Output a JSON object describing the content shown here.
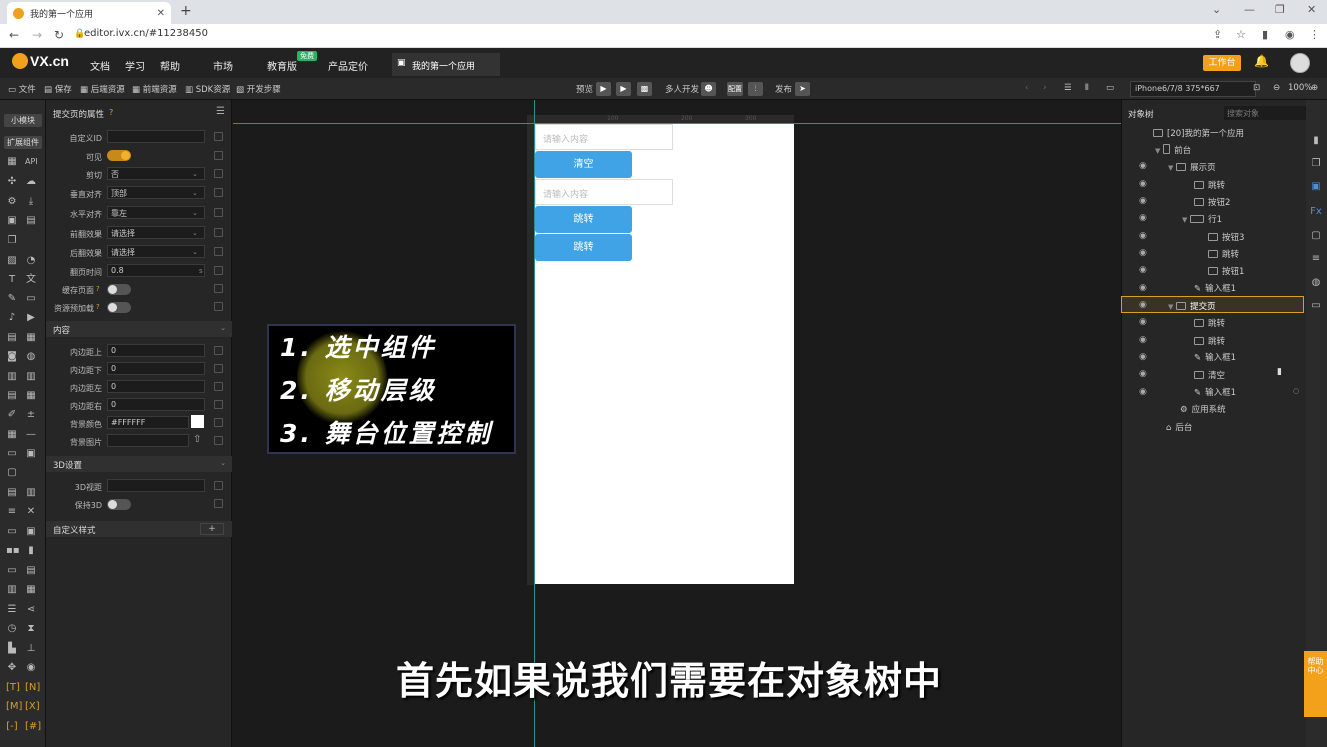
{
  "browser": {
    "tab_title": "我的第一个应用",
    "new_tab": "+",
    "url": "editor.ivx.cn/#11238450"
  },
  "header": {
    "logo": "VX.cn",
    "menus": [
      "文档",
      "学习",
      "帮助",
      "市场",
      "教育版",
      "产品定价"
    ],
    "free_badge": "免费",
    "app_tab": "我的第一个应用",
    "workbench": "工作台"
  },
  "toolbar": {
    "left": [
      "文件",
      "保存",
      "后端资源",
      "前端资源",
      "SDK资源",
      "开发步骤"
    ],
    "preview": "预览",
    "multi_dev": "多人开发",
    "config": "配置",
    "publish": "发布",
    "device": "iPhone6/7/8 375*667",
    "zoom": "100%"
  },
  "icon_strip": {
    "tab1": "小模块",
    "tab2": "扩展组件",
    "api": "API"
  },
  "props": {
    "title": "提交页的属性",
    "rows": [
      {
        "label": "自定义ID",
        "value": ""
      },
      {
        "label": "可见",
        "toggle": true
      },
      {
        "label": "剪切",
        "value": "否"
      },
      {
        "label": "垂直对齐",
        "value": "顶部"
      },
      {
        "label": "水平对齐",
        "value": "靠左"
      },
      {
        "label": "前翻效果",
        "value": "请选择"
      },
      {
        "label": "后翻效果",
        "value": "请选择"
      },
      {
        "label": "翻页时间",
        "value": "0.8",
        "unit": "s"
      },
      {
        "label": "缓存页面",
        "toggle": false
      },
      {
        "label": "资源预加载",
        "toggle": false
      }
    ],
    "section_content": "内容",
    "content_rows": [
      {
        "label": "内边距上",
        "value": "0"
      },
      {
        "label": "内边距下",
        "value": "0"
      },
      {
        "label": "内边距左",
        "value": "0"
      },
      {
        "label": "内边距右",
        "value": "0"
      },
      {
        "label": "背景颜色",
        "value": "#FFFFFF"
      },
      {
        "label": "背景图片",
        "value": ""
      }
    ],
    "section_3d": "3D设置",
    "rows_3d": [
      {
        "label": "3D视距",
        "value": ""
      },
      {
        "label": "保持3D",
        "toggle": false
      }
    ],
    "section_custom": "自定义样式",
    "add": "+"
  },
  "canvas": {
    "ruler_marks": [
      "100",
      "200",
      "300"
    ],
    "input1_placeholder": "请输入内容",
    "btn_clear": "清空",
    "input2_placeholder": "请输入内容",
    "btn_jump1": "跳转",
    "btn_jump2": "跳转"
  },
  "overlay": {
    "line1": "1.  选中组件",
    "line2": "2.  移动层级",
    "line3": "3.  舞台位置控制"
  },
  "subtitle": "首先如果说我们需要在对象树中",
  "tree": {
    "title": "对象树",
    "search_placeholder": "搜索对象",
    "nodes": [
      {
        "label": "[20]我的第一个应用"
      },
      {
        "label": "前台"
      },
      {
        "label": "展示页"
      },
      {
        "label": "跳转"
      },
      {
        "label": "按钮2"
      },
      {
        "label": "行1"
      },
      {
        "label": "按钮3"
      },
      {
        "label": "跳转"
      },
      {
        "label": "按钮1"
      },
      {
        "label": "输入框1"
      },
      {
        "label": "提交页"
      },
      {
        "label": "跳转"
      },
      {
        "label": "跳转"
      },
      {
        "label": "输入框1"
      },
      {
        "label": "清空"
      },
      {
        "label": "输入框1"
      },
      {
        "label": "应用系统"
      },
      {
        "label": "后台"
      }
    ]
  },
  "help": "帮助中心"
}
